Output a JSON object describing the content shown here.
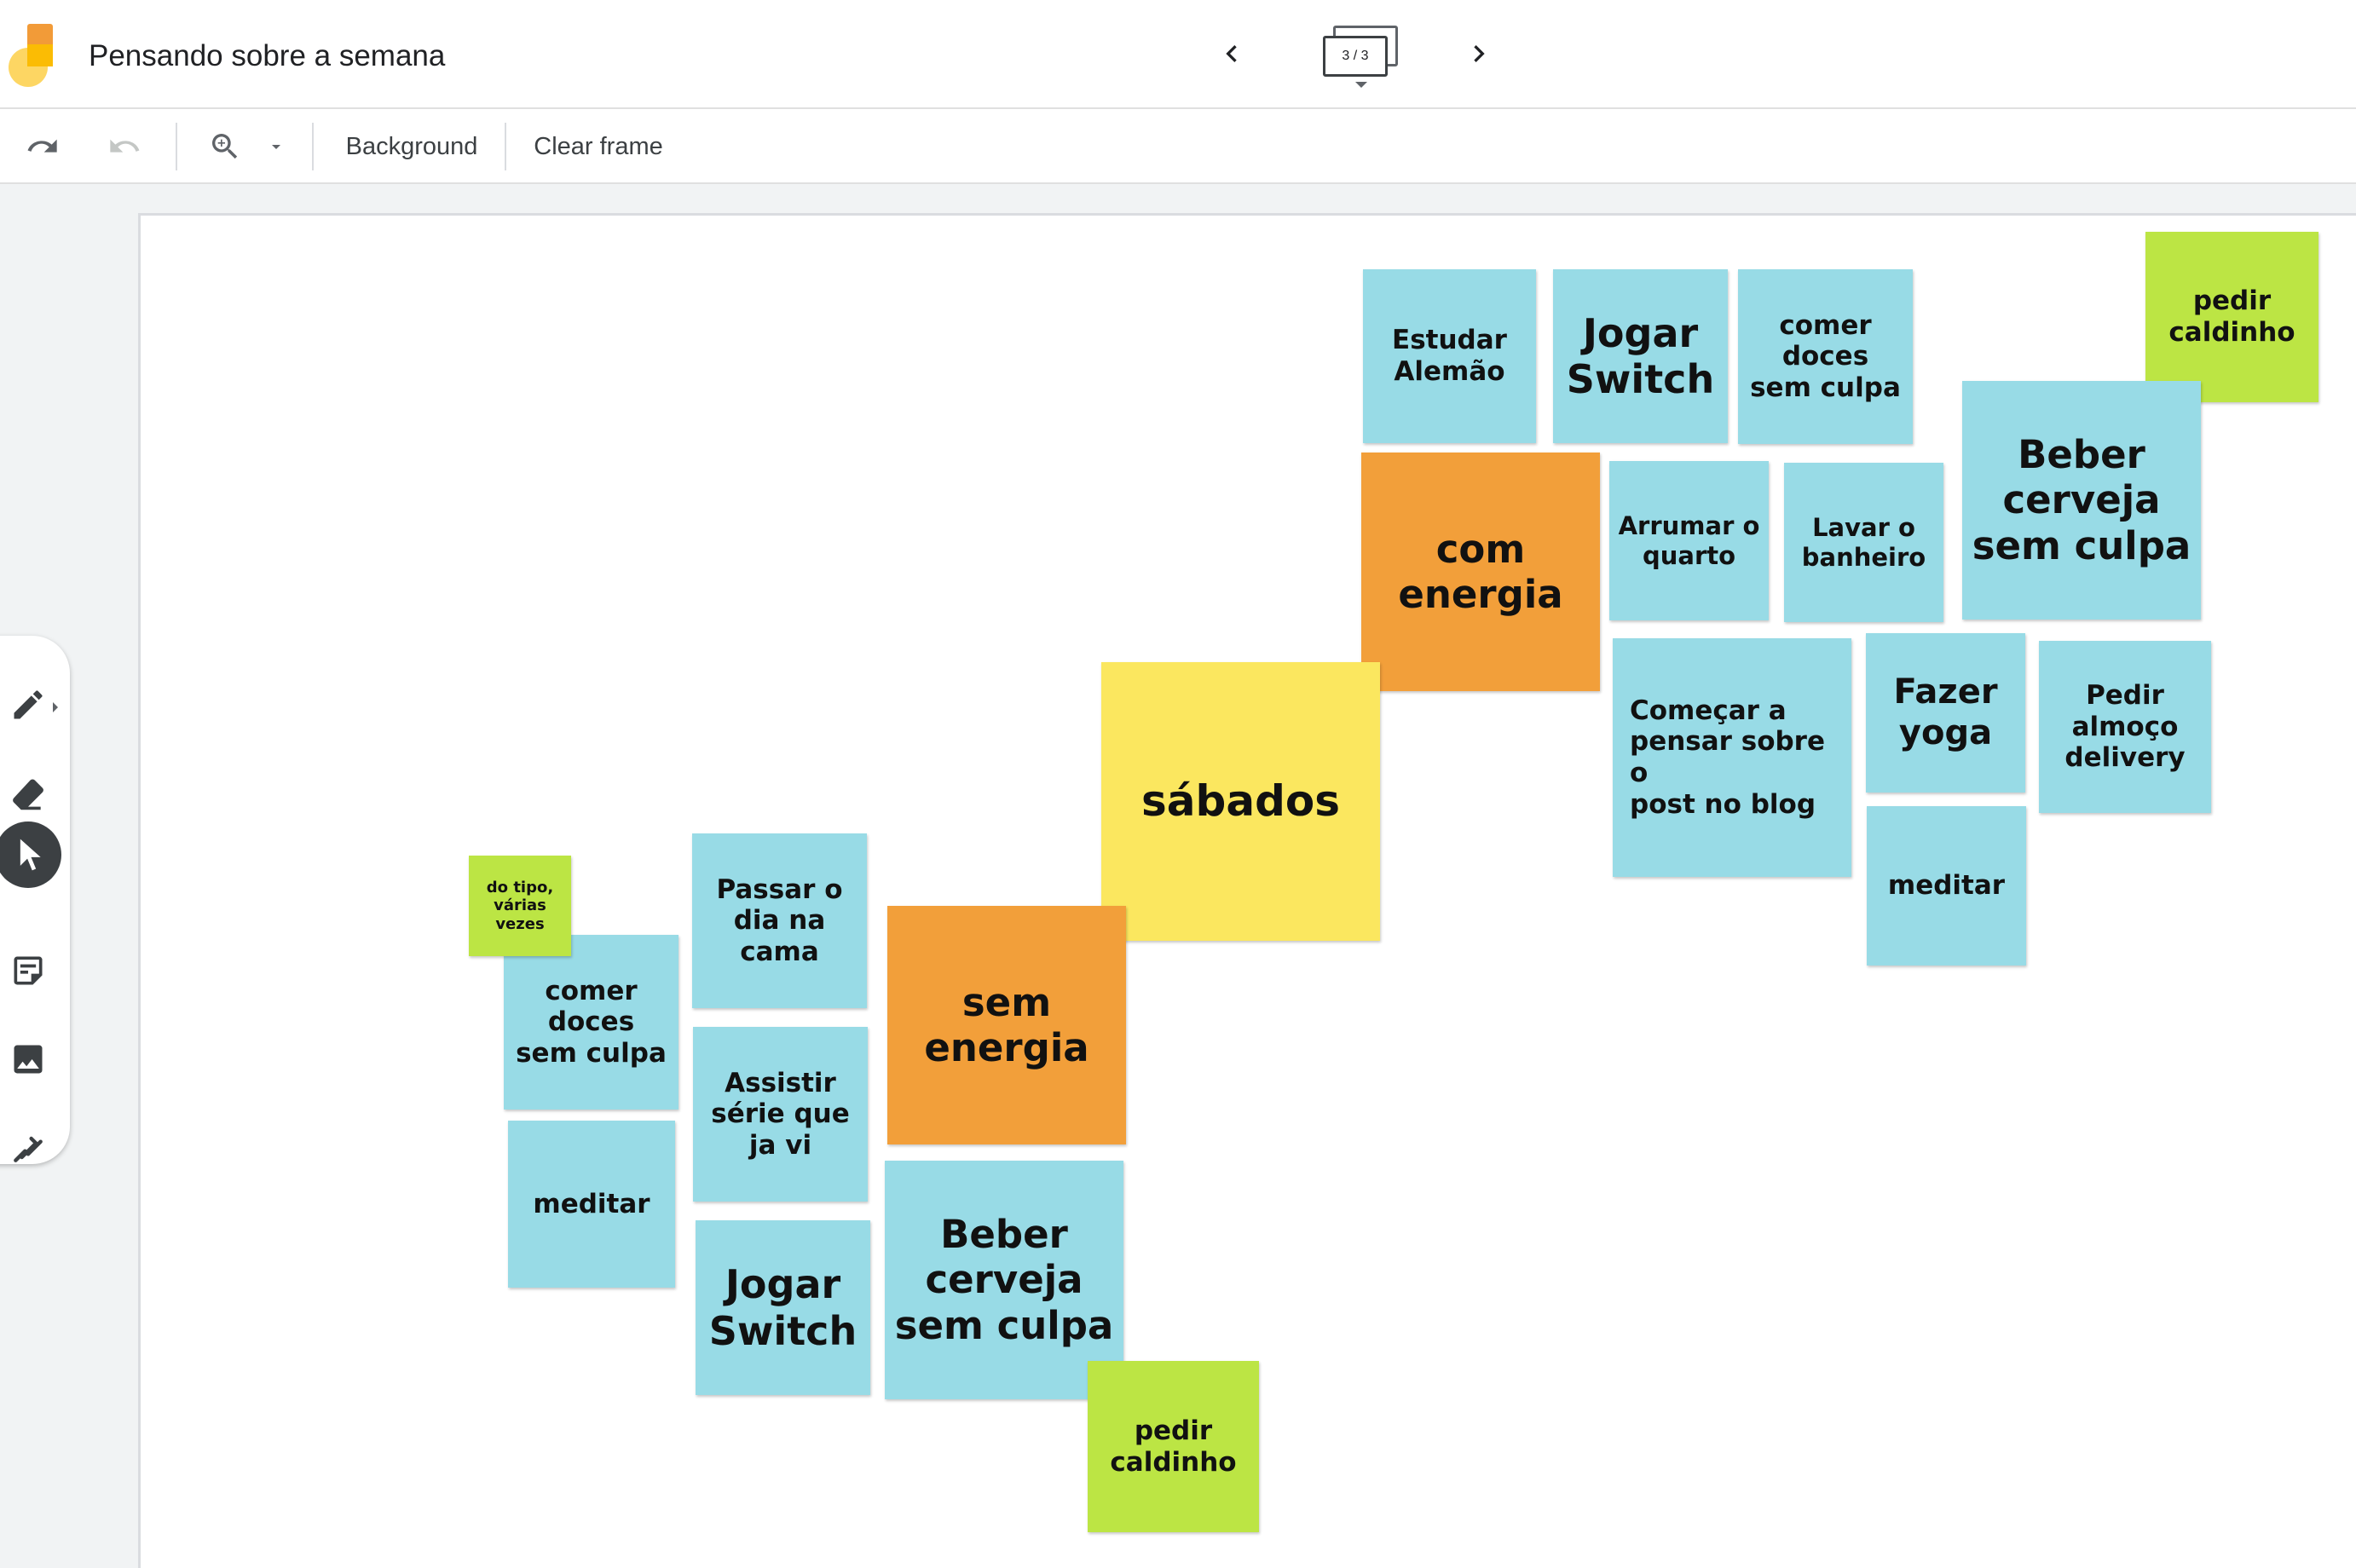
{
  "title_bar": {
    "doc_title": "Pensando sobre a semana",
    "frame_counter": "3 / 3"
  },
  "toolbar": {
    "background_label": "Background",
    "clear_frame_label": "Clear frame"
  },
  "notes": {
    "estudar_alemao": "Estudar\nAlemão",
    "jogar_switch_top": "Jogar\nSwitch",
    "comer_doces_top": "comer\ndoces\nsem culpa",
    "pedir_caldinho_top": "pedir\ncaldinho",
    "com_energia": "com\nenergia",
    "arrumar_quarto": "Arrumar o\nquarto",
    "lavar_banheiro": "Lavar o\nbanheiro",
    "beber_cerveja_top": "Beber\ncerveja\nsem culpa",
    "sabados": "sábados",
    "comecar_pensar": "Começar a\npensar sobre o\npost no blog",
    "fazer_yoga": "Fazer\nyoga",
    "pedir_almoco": "Pedir\nalmoço\ndelivery",
    "meditar_right": "meditar",
    "do_tipo": "do tipo,\nvárias\nvezes",
    "comer_doces_left": "comer\ndoces\nsem culpa",
    "passar_dia": "Passar o\ndia na\ncama",
    "sem_energia": "sem\nenergia",
    "assistir_serie": "Assistir\nsérie que\nja vi",
    "meditar_left": "meditar",
    "jogar_switch_bottom": "Jogar\nSwitch",
    "beber_cerveja_bottom": "Beber\ncerveja\nsem culpa",
    "pedir_caldinho_bottom": "pedir\ncaldinho"
  },
  "colors": {
    "blue_note": "#98dbe6",
    "orange_note": "#f29f3a",
    "yellow_note": "#fbe75f",
    "green_note": "#bce544",
    "logo_orange": "#f29b38",
    "logo_yellow": "#fdd663"
  },
  "icons": {
    "undo": "undo-icon",
    "redo": "redo-icon",
    "zoom": "zoom-in-icon",
    "pen": "pen-icon",
    "eraser": "eraser-icon",
    "select": "select-arrow-icon",
    "sticky_note": "sticky-note-icon",
    "image": "image-icon",
    "laser": "laser-icon"
  }
}
